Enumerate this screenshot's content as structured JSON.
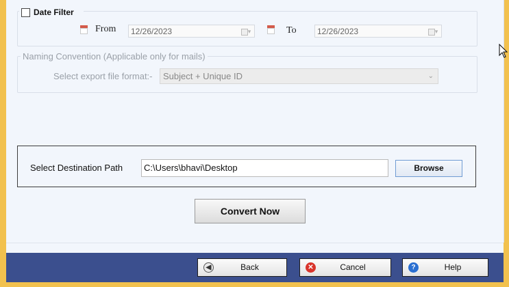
{
  "date_filter": {
    "checkbox_label": "Date Filter",
    "checked": false,
    "from_label": "From",
    "from_value": "12/26/2023",
    "to_label": "To",
    "to_value": "12/26/2023"
  },
  "naming": {
    "legend": "Naming Convention (Applicable only for mails)",
    "format_label": "Select export file format:-",
    "format_value": "Subject + Unique ID"
  },
  "destination": {
    "label": "Select Destination Path",
    "path": "C:\\Users\\bhavi\\Desktop",
    "browse_label": "Browse"
  },
  "convert_label": "Convert Now",
  "footer": {
    "back_label": "Back",
    "cancel_label": "Cancel",
    "help_label": "Help"
  },
  "colors": {
    "window_frame": "#f2c14e",
    "footer_bar": "#3b4f8e",
    "panel_bg": "#f2f6fc"
  }
}
